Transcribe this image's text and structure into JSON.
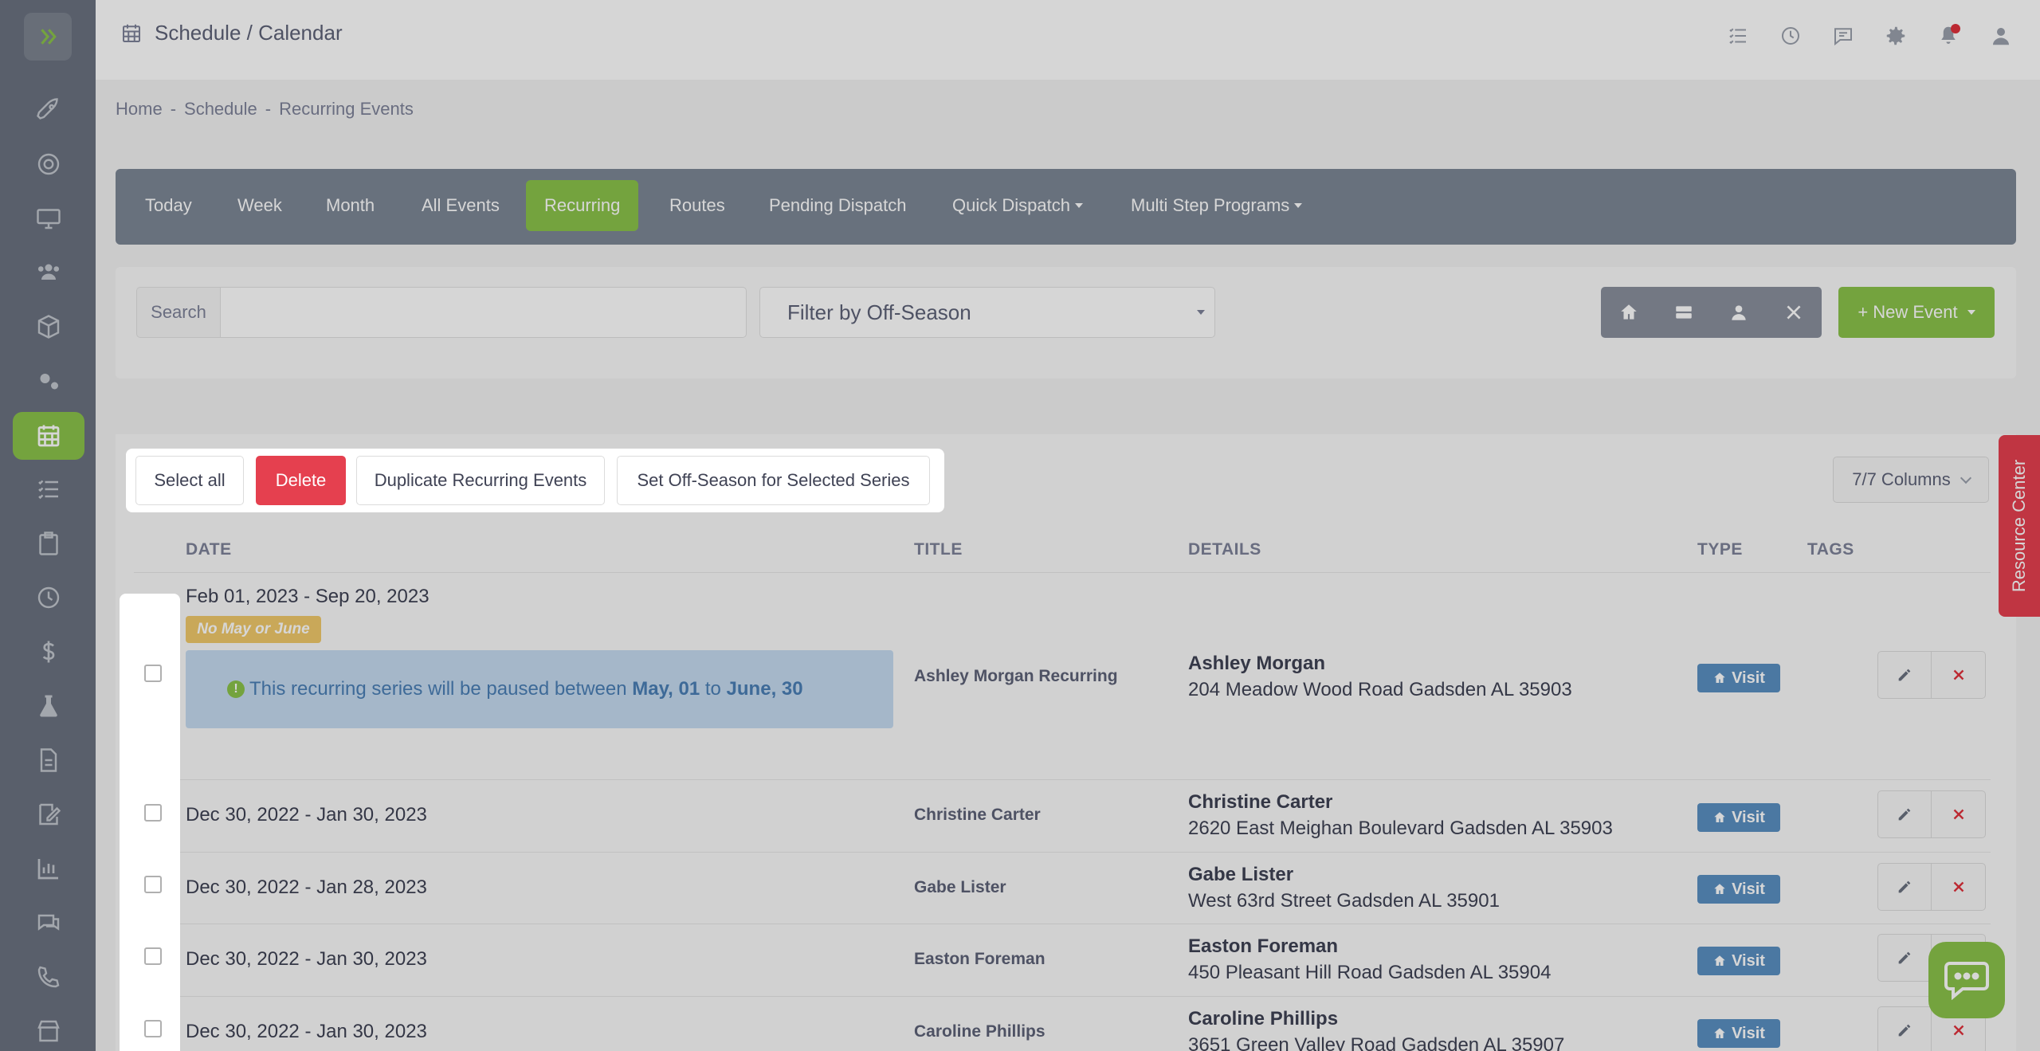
{
  "header": {
    "title": "Schedule / Calendar"
  },
  "breadcrumb": [
    "Home",
    "Schedule",
    "Recurring Events"
  ],
  "nav": {
    "tabs": [
      {
        "label": "Today"
      },
      {
        "label": "Week"
      },
      {
        "label": "Month"
      },
      {
        "label": "All Events"
      },
      {
        "label": "Recurring",
        "active": true
      },
      {
        "label": "Routes"
      },
      {
        "label": "Pending Dispatch"
      },
      {
        "label": "Quick Dispatch"
      },
      {
        "label": "Multi Step Programs"
      }
    ]
  },
  "filters": {
    "search_label": "Search",
    "search_value": "",
    "off_season_selected": "Filter by Off-Season",
    "new_event_label": "New Event"
  },
  "toolbar": {
    "select_all": "Select all",
    "delete": "Delete",
    "duplicate": "Duplicate Recurring Events",
    "set_off_season": "Set Off-Season for Selected Series",
    "columns": "7/7 Columns"
  },
  "table": {
    "headers": [
      "DATE",
      "TITLE",
      "DETAILS",
      "TYPE",
      "TAGS"
    ],
    "rows": [
      {
        "date": "Feb 01, 2023 - Sep 20, 2023",
        "title": "Ashley Morgan Recurring",
        "name": "Ashley Morgan",
        "address": "204 Meadow Wood Road Gadsden AL 35903",
        "type": "Visit"
      },
      {
        "date": "Dec 30, 2022 - Jan 30, 2023",
        "title": "Christine Carter",
        "name": "Christine Carter",
        "address": "2620 East Meighan Boulevard Gadsden AL 35903",
        "type": "Visit"
      },
      {
        "date": "Dec 30, 2022 - Jan 28, 2023",
        "title": "Gabe Lister",
        "name": "Gabe Lister",
        "address": "West 63rd Street Gadsden AL 35901",
        "type": "Visit"
      },
      {
        "date": "Dec 30, 2022 - Jan 30, 2023",
        "title": "Easton Foreman",
        "name": "Easton Foreman",
        "address": "450 Pleasant Hill Road Gadsden AL 35904",
        "type": "Visit"
      },
      {
        "date": "Dec 30, 2022 - Jan 30, 2023",
        "title": "Caroline Phillips",
        "name": "Caroline Phillips",
        "address": "3651 Green Valley Road Gadsden AL 35907",
        "type": "Visit"
      }
    ],
    "first_row_badge": "No May or June",
    "pause_notice": {
      "prefix": "This recurring series will be paused between",
      "start": "May, 01",
      "connector": "to",
      "end": "June, 30"
    }
  },
  "resource_center": "Resource Center",
  "colors": {
    "accent": "#8bc34a",
    "danger": "#e5404f",
    "sidebar": "#6b7280",
    "badge": "#5a8fc2"
  }
}
